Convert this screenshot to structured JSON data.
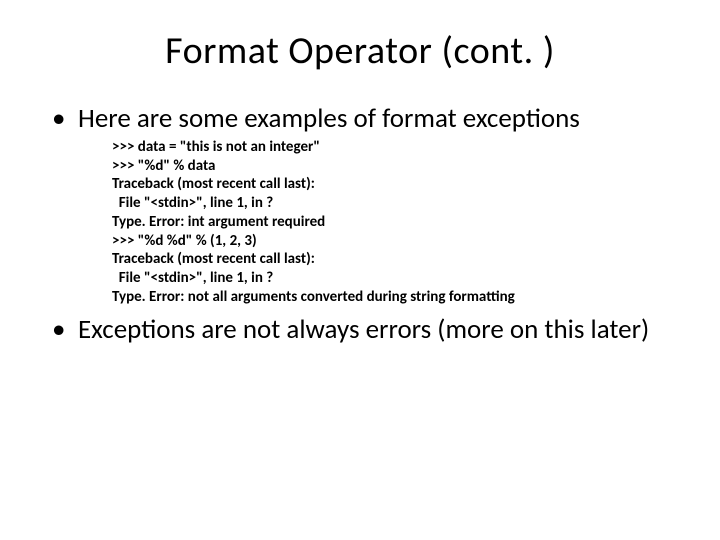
{
  "title": "Format Operator (cont. )",
  "bullets": {
    "b1": "Here are some examples of format exceptions",
    "b2": "Exceptions are not  always errors (more on this later)"
  },
  "code": ">>> data = \"this is not an integer\"\n>>> \"%d\" % data\nTraceback (most recent call last):\n  File \"<stdin>\", line 1, in ?\nType. Error: int argument required\n>>> \"%d %d\" % (1, 2, 3)\nTraceback (most recent call last):\n  File \"<stdin>\", line 1, in ?\nType. Error: not all arguments converted during string formatting"
}
